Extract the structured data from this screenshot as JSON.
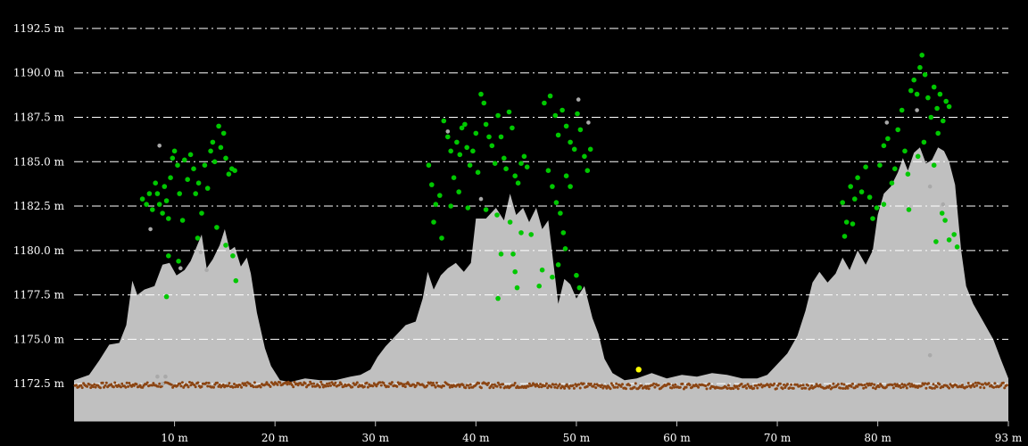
{
  "chart_data": {
    "type": "area",
    "title": "",
    "xlabel": "",
    "ylabel": "",
    "xlim": [
      0,
      93
    ],
    "ylim": [
      1170.4,
      1193.6
    ],
    "grid": true,
    "colors": {
      "background": "#000000",
      "profile": "#c0c0c0",
      "grid": "#ffffff",
      "vegetation": "#00c800",
      "ground": "#8b4513",
      "unclassified": "#a9a9a9",
      "highlight": "#ffff00"
    },
    "y_ticks": [
      {
        "value": 1172.5,
        "label": "1172.5 m"
      },
      {
        "value": 1175.0,
        "label": "1175.0 m"
      },
      {
        "value": 1177.5,
        "label": "1177.5 m"
      },
      {
        "value": 1180.0,
        "label": "1180.0 m"
      },
      {
        "value": 1182.5,
        "label": "1182.5 m"
      },
      {
        "value": 1185.0,
        "label": "1185.0 m"
      },
      {
        "value": 1187.5,
        "label": "1187.5 m"
      },
      {
        "value": 1190.0,
        "label": "1190.0 m"
      },
      {
        "value": 1192.5,
        "label": "1192.5 m"
      }
    ],
    "x_ticks": [
      {
        "value": 10,
        "label": "10 m"
      },
      {
        "value": 20,
        "label": "20 m"
      },
      {
        "value": 30,
        "label": "30 m"
      },
      {
        "value": 40,
        "label": "40 m"
      },
      {
        "value": 50,
        "label": "50 m"
      },
      {
        "value": 60,
        "label": "60 m"
      },
      {
        "value": 70,
        "label": "70 m"
      },
      {
        "value": 80,
        "label": "80 m"
      },
      {
        "value": 93,
        "label": "93 m"
      }
    ],
    "profile": {
      "name": "surface",
      "points": [
        [
          0,
          1172.7
        ],
        [
          1.5,
          1173.0
        ],
        [
          2.5,
          1173.8
        ],
        [
          3.5,
          1174.7
        ],
        [
          4.5,
          1174.8
        ],
        [
          5.2,
          1175.8
        ],
        [
          5.8,
          1178.3
        ],
        [
          6.3,
          1177.5
        ],
        [
          7.0,
          1177.8
        ],
        [
          8.0,
          1178.0
        ],
        [
          8.8,
          1179.2
        ],
        [
          9.5,
          1179.3
        ],
        [
          10.2,
          1178.6
        ],
        [
          11.0,
          1178.9
        ],
        [
          11.6,
          1179.4
        ],
        [
          12.2,
          1180.2
        ],
        [
          12.7,
          1180.9
        ],
        [
          13.2,
          1179.0
        ],
        [
          13.8,
          1179.5
        ],
        [
          14.5,
          1180.3
        ],
        [
          15.0,
          1181.2
        ],
        [
          15.5,
          1180.0
        ],
        [
          16.0,
          1180.2
        ],
        [
          16.6,
          1179.1
        ],
        [
          17.2,
          1179.6
        ],
        [
          17.6,
          1178.7
        ],
        [
          18.2,
          1176.5
        ],
        [
          19.0,
          1174.5
        ],
        [
          19.6,
          1173.5
        ],
        [
          20.5,
          1172.7
        ],
        [
          21.5,
          1172.6
        ],
        [
          23.0,
          1172.8
        ],
        [
          24.5,
          1172.7
        ],
        [
          26.0,
          1172.7
        ],
        [
          27.5,
          1172.9
        ],
        [
          28.5,
          1173.0
        ],
        [
          29.5,
          1173.3
        ],
        [
          30.2,
          1174.0
        ],
        [
          31.0,
          1174.6
        ],
        [
          32.0,
          1175.2
        ],
        [
          33.0,
          1175.8
        ],
        [
          34.0,
          1176.0
        ],
        [
          34.7,
          1177.3
        ],
        [
          35.2,
          1178.8
        ],
        [
          35.8,
          1177.8
        ],
        [
          36.5,
          1178.6
        ],
        [
          37.2,
          1179.0
        ],
        [
          38.0,
          1179.3
        ],
        [
          38.8,
          1178.8
        ],
        [
          39.5,
          1179.3
        ],
        [
          40.0,
          1181.8
        ],
        [
          41.0,
          1181.8
        ],
        [
          42.0,
          1182.4
        ],
        [
          42.8,
          1181.7
        ],
        [
          43.4,
          1183.2
        ],
        [
          44.0,
          1182.0
        ],
        [
          44.7,
          1182.4
        ],
        [
          45.3,
          1181.6
        ],
        [
          46.0,
          1182.4
        ],
        [
          46.6,
          1181.2
        ],
        [
          47.2,
          1181.7
        ],
        [
          47.8,
          1178.9
        ],
        [
          48.2,
          1177.0
        ],
        [
          48.8,
          1178.4
        ],
        [
          49.4,
          1178.1
        ],
        [
          50.0,
          1177.3
        ],
        [
          50.8,
          1178.0
        ],
        [
          51.6,
          1176.2
        ],
        [
          52.2,
          1175.3
        ],
        [
          52.8,
          1173.9
        ],
        [
          53.6,
          1173.1
        ],
        [
          54.8,
          1172.7
        ],
        [
          56.0,
          1172.8
        ],
        [
          57.5,
          1173.1
        ],
        [
          59.0,
          1172.8
        ],
        [
          60.5,
          1173.0
        ],
        [
          62.0,
          1172.9
        ],
        [
          63.5,
          1173.1
        ],
        [
          65.0,
          1173.0
        ],
        [
          66.5,
          1172.8
        ],
        [
          68.0,
          1172.8
        ],
        [
          69.0,
          1173.0
        ],
        [
          70.0,
          1173.6
        ],
        [
          71.0,
          1174.2
        ],
        [
          72.0,
          1175.2
        ],
        [
          72.8,
          1176.6
        ],
        [
          73.5,
          1178.2
        ],
        [
          74.2,
          1178.8
        ],
        [
          75.0,
          1178.2
        ],
        [
          75.8,
          1178.7
        ],
        [
          76.5,
          1179.6
        ],
        [
          77.2,
          1178.9
        ],
        [
          78.0,
          1180.0
        ],
        [
          78.8,
          1179.2
        ],
        [
          79.5,
          1180.0
        ],
        [
          80.0,
          1182.0
        ],
        [
          80.6,
          1183.2
        ],
        [
          81.3,
          1183.6
        ],
        [
          82.0,
          1184.4
        ],
        [
          82.5,
          1185.2
        ],
        [
          83.0,
          1184.5
        ],
        [
          83.6,
          1185.5
        ],
        [
          84.2,
          1185.8
        ],
        [
          84.8,
          1184.9
        ],
        [
          85.4,
          1185.1
        ],
        [
          86.0,
          1185.8
        ],
        [
          86.6,
          1185.6
        ],
        [
          87.1,
          1185.0
        ],
        [
          87.7,
          1183.7
        ],
        [
          88.3,
          1180.0
        ],
        [
          88.8,
          1178.0
        ],
        [
          89.5,
          1177.0
        ],
        [
          90.5,
          1176.0
        ],
        [
          91.5,
          1175.0
        ],
        [
          92.3,
          1173.8
        ],
        [
          93.0,
          1172.8
        ]
      ]
    },
    "series": [
      {
        "name": "",
        "kind": "vegetation",
        "color": "#00c800",
        "points": [
          [
            6.8,
            1182.9
          ],
          [
            7.2,
            1182.6
          ],
          [
            7.5,
            1183.2
          ],
          [
            7.8,
            1182.3
          ],
          [
            8.1,
            1183.8
          ],
          [
            8.3,
            1183.2
          ],
          [
            8.5,
            1182.6
          ],
          [
            8.8,
            1182.1
          ],
          [
            9.0,
            1183.6
          ],
          [
            9.2,
            1182.8
          ],
          [
            9.4,
            1181.8
          ],
          [
            9.6,
            1184.1
          ],
          [
            9.8,
            1185.2
          ],
          [
            10.0,
            1185.6
          ],
          [
            10.3,
            1184.8
          ],
          [
            10.5,
            1183.2
          ],
          [
            10.8,
            1181.7
          ],
          [
            11.0,
            1185.1
          ],
          [
            11.3,
            1184.0
          ],
          [
            11.6,
            1185.4
          ],
          [
            11.9,
            1184.6
          ],
          [
            12.1,
            1183.2
          ],
          [
            12.4,
            1183.8
          ],
          [
            12.7,
            1182.1
          ],
          [
            13.0,
            1184.8
          ],
          [
            13.3,
            1183.5
          ],
          [
            13.6,
            1185.6
          ],
          [
            13.8,
            1186.1
          ],
          [
            14.0,
            1185.0
          ],
          [
            14.2,
            1181.3
          ],
          [
            14.4,
            1187.0
          ],
          [
            14.6,
            1185.8
          ],
          [
            14.9,
            1186.6
          ],
          [
            15.1,
            1185.2
          ],
          [
            15.4,
            1184.3
          ],
          [
            15.7,
            1184.6
          ],
          [
            16.0,
            1184.5
          ],
          [
            15.1,
            1180.3
          ],
          [
            15.8,
            1179.7
          ],
          [
            16.1,
            1178.3
          ],
          [
            12.3,
            1180.7
          ],
          [
            9.4,
            1179.7
          ],
          [
            10.4,
            1179.4
          ],
          [
            9.2,
            1177.4
          ],
          [
            36.8,
            1187.3
          ],
          [
            37.2,
            1186.4
          ],
          [
            37.5,
            1185.6
          ],
          [
            37.8,
            1184.1
          ],
          [
            38.1,
            1186.1
          ],
          [
            38.4,
            1185.4
          ],
          [
            38.6,
            1186.9
          ],
          [
            38.9,
            1187.1
          ],
          [
            39.1,
            1185.8
          ],
          [
            39.4,
            1184.8
          ],
          [
            39.7,
            1185.6
          ],
          [
            40.0,
            1186.6
          ],
          [
            40.2,
            1184.4
          ],
          [
            40.5,
            1188.8
          ],
          [
            40.8,
            1188.3
          ],
          [
            41.0,
            1187.1
          ],
          [
            41.3,
            1186.4
          ],
          [
            41.6,
            1185.9
          ],
          [
            41.9,
            1184.9
          ],
          [
            42.2,
            1187.6
          ],
          [
            42.5,
            1186.4
          ],
          [
            42.8,
            1185.2
          ],
          [
            43.0,
            1184.6
          ],
          [
            43.3,
            1187.8
          ],
          [
            43.6,
            1186.9
          ],
          [
            43.9,
            1184.2
          ],
          [
            44.2,
            1183.8
          ],
          [
            44.5,
            1184.9
          ],
          [
            44.8,
            1185.3
          ],
          [
            45.1,
            1184.7
          ],
          [
            35.3,
            1184.8
          ],
          [
            35.6,
            1183.7
          ],
          [
            36.0,
            1182.6
          ],
          [
            36.4,
            1183.1
          ],
          [
            35.8,
            1181.6
          ],
          [
            36.6,
            1180.7
          ],
          [
            37.5,
            1182.5
          ],
          [
            38.3,
            1183.3
          ],
          [
            39.2,
            1182.4
          ],
          [
            41.0,
            1182.3
          ],
          [
            42.1,
            1182.0
          ],
          [
            43.4,
            1181.6
          ],
          [
            44.5,
            1181.0
          ],
          [
            45.5,
            1180.9
          ],
          [
            42.5,
            1179.8
          ],
          [
            43.7,
            1179.8
          ],
          [
            44.1,
            1177.9
          ],
          [
            42.2,
            1177.3
          ],
          [
            43.9,
            1178.8
          ],
          [
            46.8,
            1188.3
          ],
          [
            47.4,
            1188.7
          ],
          [
            47.9,
            1187.6
          ],
          [
            48.2,
            1186.5
          ],
          [
            48.6,
            1187.9
          ],
          [
            49.0,
            1187.0
          ],
          [
            49.4,
            1186.1
          ],
          [
            49.8,
            1185.7
          ],
          [
            50.1,
            1187.7
          ],
          [
            50.4,
            1186.8
          ],
          [
            50.8,
            1185.3
          ],
          [
            51.1,
            1184.5
          ],
          [
            51.4,
            1185.7
          ],
          [
            47.2,
            1184.5
          ],
          [
            47.6,
            1183.6
          ],
          [
            48.0,
            1182.7
          ],
          [
            48.4,
            1182.1
          ],
          [
            48.7,
            1181.0
          ],
          [
            49.0,
            1184.2
          ],
          [
            49.4,
            1183.6
          ],
          [
            48.2,
            1179.2
          ],
          [
            48.9,
            1180.1
          ],
          [
            50.0,
            1178.6
          ],
          [
            50.3,
            1177.9
          ],
          [
            47.6,
            1178.5
          ],
          [
            46.3,
            1178.0
          ],
          [
            46.6,
            1178.9
          ],
          [
            76.5,
            1182.7
          ],
          [
            76.9,
            1181.6
          ],
          [
            77.3,
            1183.6
          ],
          [
            77.7,
            1182.9
          ],
          [
            78.0,
            1184.1
          ],
          [
            78.4,
            1183.3
          ],
          [
            78.8,
            1184.7
          ],
          [
            79.2,
            1183.0
          ],
          [
            79.5,
            1181.8
          ],
          [
            79.9,
            1182.4
          ],
          [
            80.2,
            1184.8
          ],
          [
            80.6,
            1185.9
          ],
          [
            81.0,
            1186.3
          ],
          [
            81.4,
            1183.8
          ],
          [
            81.7,
            1184.6
          ],
          [
            82.0,
            1186.8
          ],
          [
            82.4,
            1187.9
          ],
          [
            82.7,
            1185.6
          ],
          [
            83.0,
            1184.3
          ],
          [
            83.3,
            1189.0
          ],
          [
            83.6,
            1189.6
          ],
          [
            83.9,
            1188.8
          ],
          [
            84.2,
            1190.3
          ],
          [
            84.4,
            1191.0
          ],
          [
            84.7,
            1189.9
          ],
          [
            85.0,
            1188.6
          ],
          [
            85.3,
            1187.5
          ],
          [
            85.6,
            1189.2
          ],
          [
            85.9,
            1188.0
          ],
          [
            86.2,
            1188.8
          ],
          [
            86.5,
            1187.3
          ],
          [
            86.8,
            1188.4
          ],
          [
            87.1,
            1188.1
          ],
          [
            86.0,
            1186.6
          ],
          [
            85.6,
            1184.8
          ],
          [
            84.6,
            1186.1
          ],
          [
            84.0,
            1185.3
          ],
          [
            86.7,
            1181.7
          ],
          [
            87.1,
            1180.6
          ],
          [
            87.6,
            1180.9
          ],
          [
            87.9,
            1180.2
          ],
          [
            85.8,
            1180.5
          ],
          [
            86.4,
            1182.1
          ],
          [
            76.7,
            1180.8
          ],
          [
            77.5,
            1181.5
          ],
          [
            80.6,
            1182.6
          ],
          [
            83.1,
            1182.3
          ]
        ]
      },
      {
        "name": "",
        "kind": "ground",
        "color": "#8b4513",
        "line_y": 1172.4,
        "jitter": 0.15
      },
      {
        "name": "",
        "kind": "unclassified",
        "color": "#a9a9a9",
        "points": [
          [
            8.5,
            1185.9
          ],
          [
            7.6,
            1181.2
          ],
          [
            12.6,
            1179.9
          ],
          [
            10.6,
            1179.0
          ],
          [
            13.2,
            1178.9
          ],
          [
            8.3,
            1172.9
          ],
          [
            8.8,
            1172.5
          ],
          [
            9.1,
            1172.9
          ],
          [
            40.5,
            1182.9
          ],
          [
            37.2,
            1186.7
          ],
          [
            50.2,
            1188.5
          ],
          [
            51.2,
            1187.2
          ],
          [
            80.9,
            1187.2
          ],
          [
            83.9,
            1187.9
          ],
          [
            85.2,
            1183.6
          ],
          [
            86.5,
            1182.6
          ],
          [
            85.2,
            1174.1
          ]
        ]
      },
      {
        "name": "",
        "kind": "highlight",
        "color": "#ffff00",
        "points": [
          [
            56.2,
            1173.3
          ]
        ]
      }
    ]
  }
}
